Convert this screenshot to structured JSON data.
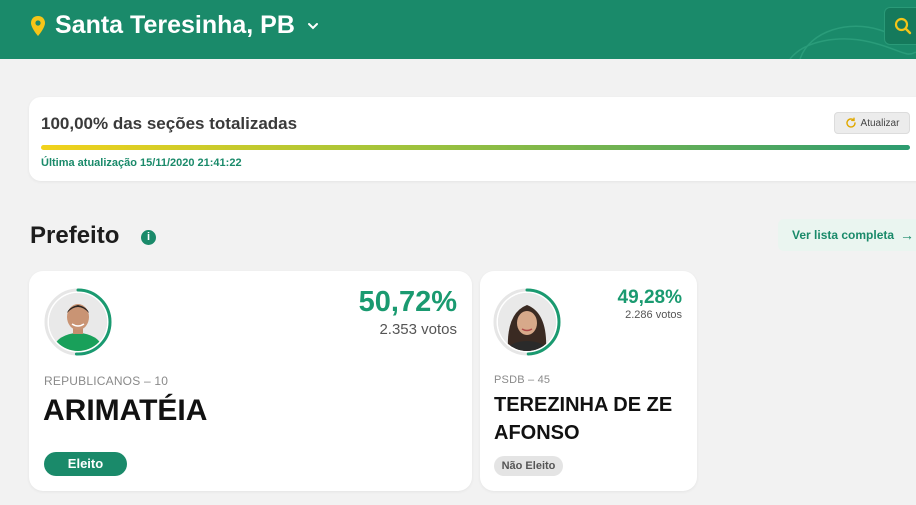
{
  "header": {
    "city": "Santa Teresinha, PB",
    "colors": {
      "bar": "#1a8a6a",
      "accent": "#f5c518"
    },
    "icons": {
      "location": "location-pin-icon",
      "dropdown": "chevron-down-icon",
      "search": "search-icon"
    }
  },
  "progress": {
    "title": "100,00% das seções totalizadas",
    "refresh_label": "Atualizar",
    "last_update": "Última atualização 15/11/2020 21:41:22",
    "fraction": 1.0
  },
  "section": {
    "title": "Prefeito",
    "info_icon_glyph": "i",
    "full_list_label": "Ver lista completa",
    "full_list_arrow": "→"
  },
  "candidates": [
    {
      "percent": "50,72%",
      "votes": "2.353 votos",
      "party": "REPUBLICANOS – 10",
      "name": "ARIMATÉIA",
      "status": "Eleito",
      "vote_share": 0.5072
    },
    {
      "percent": "49,28%",
      "votes": "2.286 votos",
      "party": "PSDB – 45",
      "name": "TEREZINHA DE ZE AFONSO",
      "status": "Não Eleito",
      "vote_share": 0.4928
    }
  ]
}
